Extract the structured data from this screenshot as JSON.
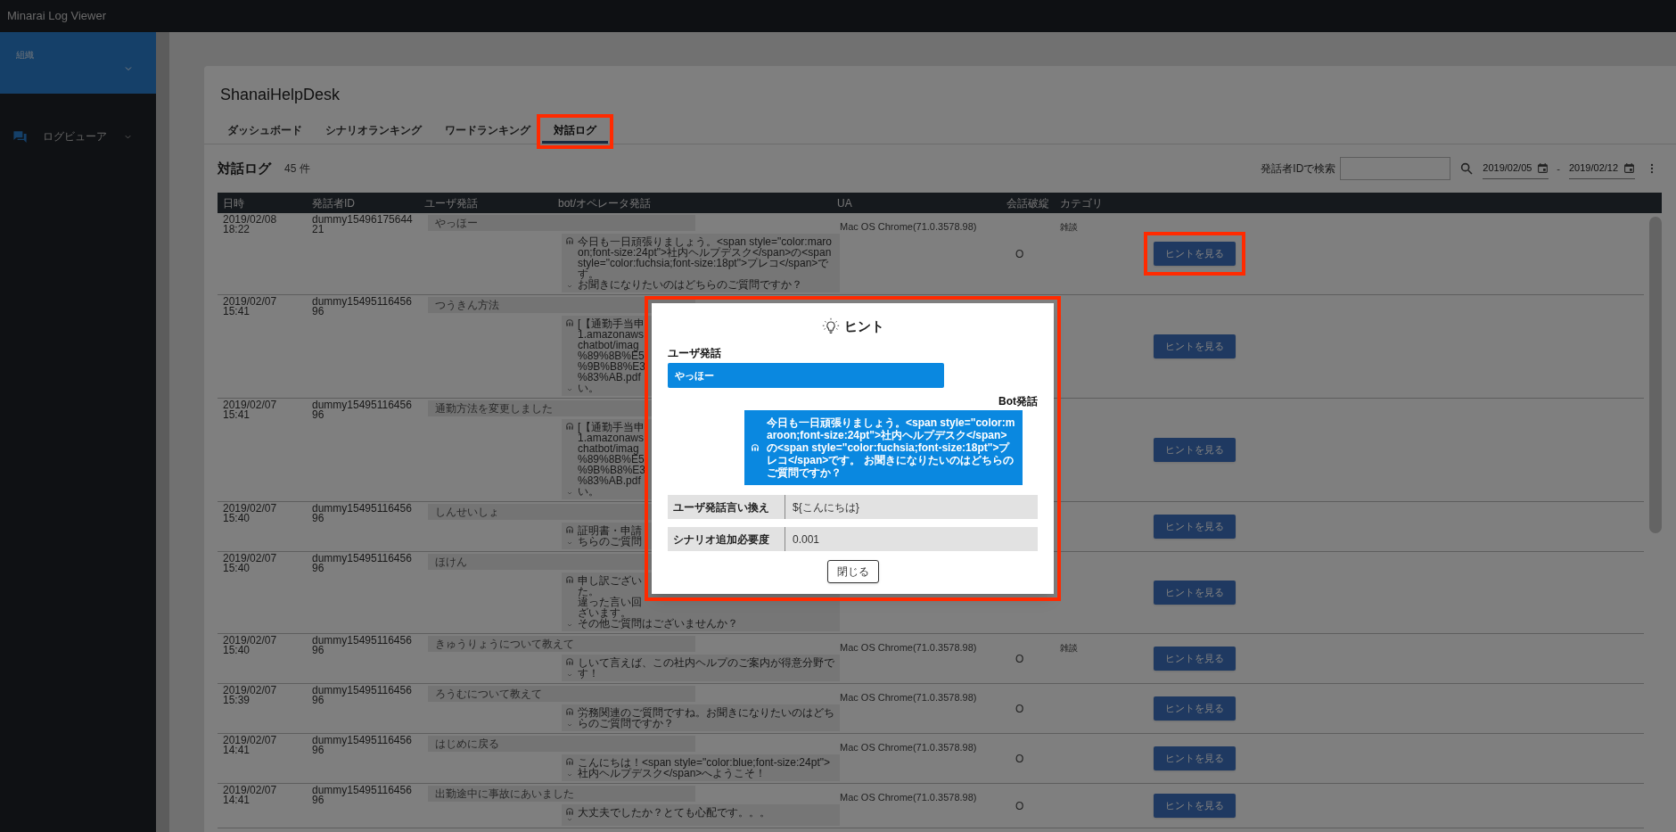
{
  "app_title": "Minarai Log Viewer",
  "sidebar": {
    "org_label": "組織",
    "nav_label": "ログビューア"
  },
  "project_title": "ShanaiHelpDesk",
  "tabs": [
    {
      "label": "ダッシュボード",
      "selected": false
    },
    {
      "label": "シナリオランキング",
      "selected": false
    },
    {
      "label": "ワードランキング",
      "selected": false
    },
    {
      "label": "対話ログ",
      "selected": true
    }
  ],
  "section": {
    "title": "対話ログ",
    "count": "45 件"
  },
  "search": {
    "label": "発話者IDで検索",
    "date_from": "2019/02/05",
    "separator": "-",
    "date_to": "2019/02/12"
  },
  "table": {
    "columns": [
      "日時",
      "発話者ID",
      "ユーザ発話",
      "bot/オペレータ発話",
      "UA",
      "会話破綻",
      "カテゴリ"
    ],
    "rows": [
      {
        "datetime": "2019/02/08 18:22",
        "speaker_id": "dummy1549617564421",
        "user_utterance": "やっほー",
        "bot_utterance": [
          "今日も一日頑張りましょう。<span style=\"color:maroon;font-size:24pt\">社内ヘルプデスク</span>の<span style=\"color:fuchsia;font-size:18pt\">プレコ</span>です。",
          "お聞きになりたいのはどちらのご質問ですか？"
        ],
        "ua": "Mac OS Chrome(71.0.3578.98)",
        "broken": "O",
        "category": "雑談",
        "hint_button": "ヒントを見る"
      },
      {
        "datetime": "2019/02/07 15:41",
        "speaker_id": "dummy1549511645696",
        "user_utterance": "つうきん方法",
        "bot_utterance": [
          "[【通勤手当申",
          "1.amazonaws",
          "chatbot/imag",
          "%89%8B%E5",
          "%9B%B8%E3",
          "%83%AB.pdf",
          "い。"
        ],
        "hint_button": "ヒントを見る"
      },
      {
        "datetime": "2019/02/07 15:41",
        "speaker_id": "dummy1549511645696",
        "user_utterance": "通勤方法を変更しました",
        "bot_utterance": [
          "[【通勤手当申",
          "1.amazonaws",
          "chatbot/imag",
          "%89%8B%E5",
          "%9B%B8%E3",
          "%83%AB.pdf",
          "い。"
        ],
        "hint_button": "ヒントを見る"
      },
      {
        "datetime": "2019/02/07 15:40",
        "speaker_id": "dummy1549511645696",
        "user_utterance": "しんせいしょ",
        "bot_utterance": [
          "証明書・申請",
          "ちらのご質問"
        ],
        "hint_button": "ヒントを見る"
      },
      {
        "datetime": "2019/02/07 15:40",
        "speaker_id": "dummy1549511645696",
        "user_utterance": "ほけん",
        "bot_utterance": [
          "申し訳ござい",
          "た。",
          "違った言い回",
          "ざいます。",
          "その他ご質問はございませんか？"
        ],
        "hint_button": "ヒントを見る"
      },
      {
        "datetime": "2019/02/07 15:40",
        "speaker_id": "dummy1549511645696",
        "user_utterance": "きゅうりょうについて教えて",
        "bot_utterance": [
          "しいて言えば、この社内ヘルプのご案内が得意分野です！"
        ],
        "ua": "Mac OS Chrome(71.0.3578.98)",
        "broken": "O",
        "category": "雑談",
        "hint_button": "ヒントを見る"
      },
      {
        "datetime": "2019/02/07 15:39",
        "speaker_id": "dummy1549511645696",
        "user_utterance": "ろうむについて教えて",
        "bot_utterance": [
          "労務関連のご質問ですね。お聞きになりたいのはどちらのご質問ですか？"
        ],
        "ua": "Mac OS Chrome(71.0.3578.98)",
        "broken": "O",
        "hint_button": "ヒントを見る"
      },
      {
        "datetime": "2019/02/07 14:41",
        "speaker_id": "dummy1549511645696",
        "user_utterance": "はじめに戻る",
        "bot_utterance": [
          "こんにちは！<span style=\"color:blue;font-size:24pt\">社内ヘルプデスク</span>へようこそ！"
        ],
        "ua": "Mac OS Chrome(71.0.3578.98)",
        "broken": "O",
        "hint_button": "ヒントを見る"
      },
      {
        "datetime": "2019/02/07 14:41",
        "speaker_id": "dummy1549511645696",
        "user_utterance": "出勤途中に事故にあいました",
        "bot_utterance": [
          "大丈夫でしたか？とても心配です。。。"
        ],
        "ua": "Mac OS Chrome(71.0.3578.98)",
        "broken": "O",
        "hint_button": "ヒントを見る"
      }
    ]
  },
  "modal": {
    "title": "ヒント",
    "user_label": "ユーザ発話",
    "user_text": "やっほー",
    "bot_label": "Bot発話",
    "bot_text": "今日も一日頑張りましょう。<span style=\"color:maroon;font-size:24pt\">社内ヘルプデスク</span>の<span style=\"color:fuchsia;font-size:18pt\">プレコ</span>です。 お聞きになりたいのはどちらのご質問ですか？",
    "details": [
      {
        "label": "ユーザ発話言い換え",
        "value": "${こんにちは}"
      },
      {
        "label": "シナリオ追加必要度",
        "value": "0.001"
      }
    ],
    "close_button": "閉じる"
  }
}
